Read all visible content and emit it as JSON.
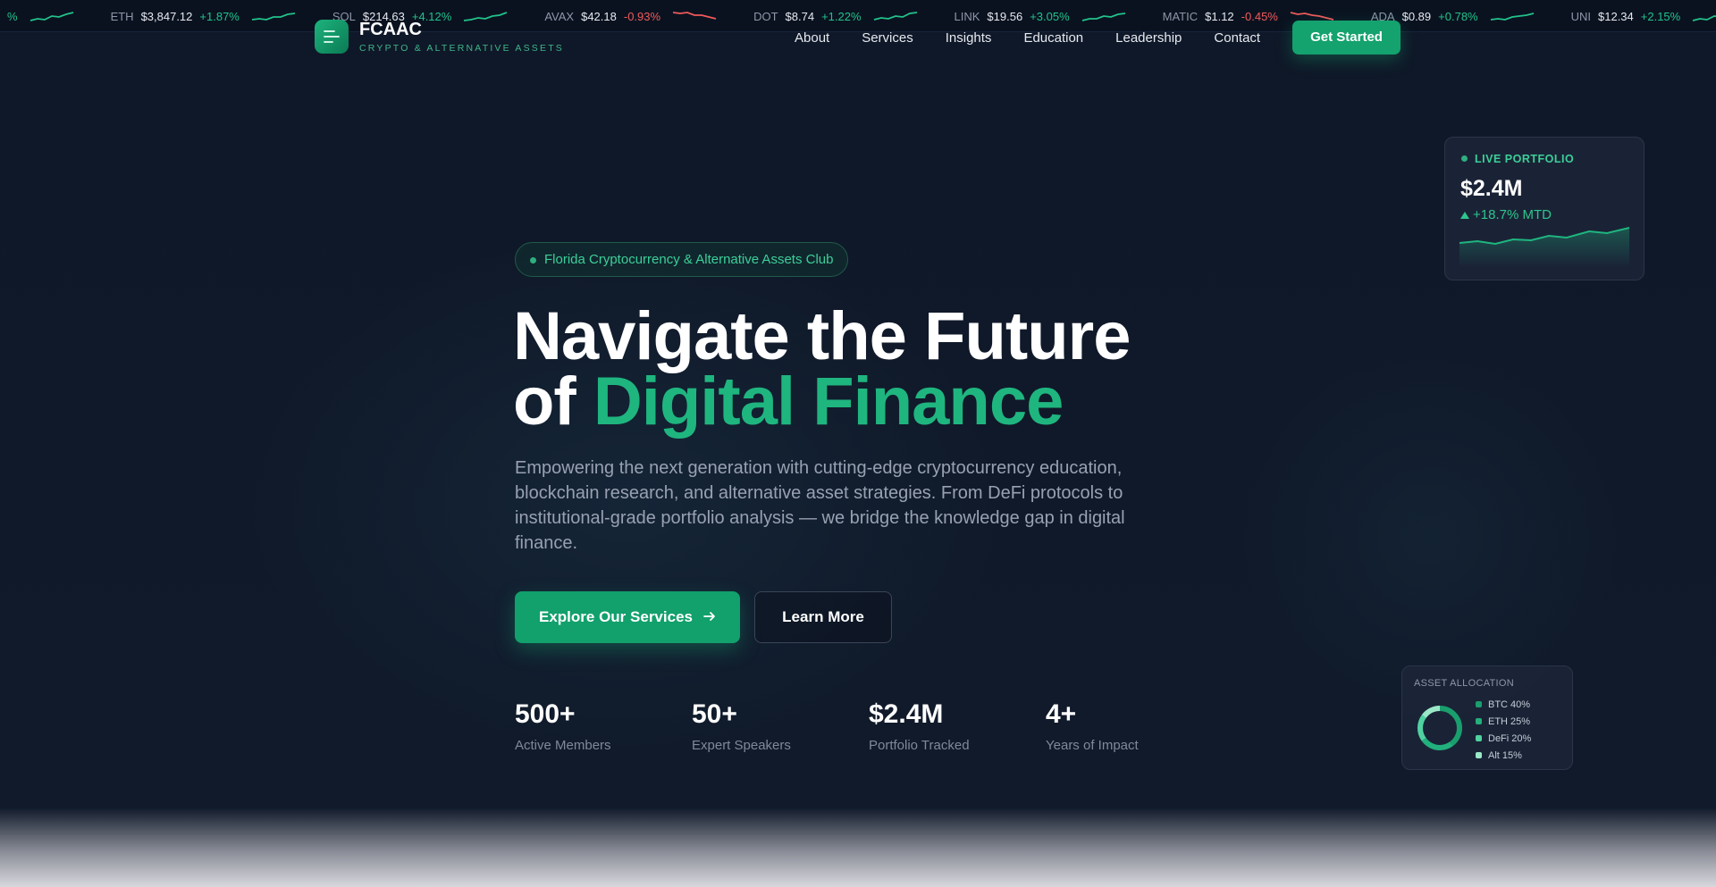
{
  "ticker": [
    {
      "symbol": "",
      "price": "",
      "change": "%",
      "dir": "up"
    },
    {
      "symbol": "ETH",
      "price": "$3,847.12",
      "change": "+1.87%",
      "dir": "up"
    },
    {
      "symbol": "SOL",
      "price": "$214.63",
      "change": "+4.12%",
      "dir": "up"
    },
    {
      "symbol": "AVAX",
      "price": "$42.18",
      "change": "-0.93%",
      "dir": "down"
    },
    {
      "symbol": "DOT",
      "price": "$8.74",
      "change": "+1.22%",
      "dir": "up"
    },
    {
      "symbol": "LINK",
      "price": "$19.56",
      "change": "+3.05%",
      "dir": "up"
    },
    {
      "symbol": "MATIC",
      "price": "$1.12",
      "change": "-0.45%",
      "dir": "down"
    },
    {
      "symbol": "ADA",
      "price": "$0.89",
      "change": "+0.78%",
      "dir": "up"
    },
    {
      "symbol": "UNI",
      "price": "$12.34",
      "change": "+2.15%",
      "dir": "up"
    }
  ],
  "header": {
    "logo_name": "FCAAC",
    "logo_tagline": "CRYPTO & ALTERNATIVE ASSETS",
    "logo_icon": "menu-icon",
    "nav": [
      "About",
      "Services",
      "Insights",
      "Education",
      "Leadership",
      "Contact"
    ],
    "cta": "Get Started"
  },
  "hero": {
    "pill": "Florida Cryptocurrency & Alternative Assets Club",
    "title_line1": "Navigate the Future",
    "title_line2_prefix": "of ",
    "title_line2_accent": "Digital Finance",
    "description": "Empowering the next generation with cutting-edge cryptocurrency education, blockchain research, and alternative asset strategies. From DeFi protocols to institutional-grade portfolio analysis — we bridge the knowledge gap in digital finance.",
    "primary_button": "Explore Our Services",
    "primary_button_icon": "arrow-right-icon",
    "secondary_button": "Learn More"
  },
  "stats": [
    {
      "value": "500+",
      "label": "Active Members"
    },
    {
      "value": "50+",
      "label": "Expert Speakers"
    },
    {
      "value": "$2.4M",
      "label": "Portfolio Tracked"
    },
    {
      "value": "4+",
      "label": "Years of Impact"
    }
  ],
  "portfolio_card": {
    "label": "LIVE PORTFOLIO",
    "value": "$2.4M",
    "change": "+18.7% MTD"
  },
  "allocation_card": {
    "label": "ASSET ALLOCATION",
    "items": [
      {
        "name": "BTC 40%",
        "color": "#1a9e6e",
        "share": 0.4
      },
      {
        "name": "ETH 25%",
        "color": "#22b07c",
        "share": 0.25
      },
      {
        "name": "DeFi 20%",
        "color": "#4fd2a0",
        "share": 0.2
      },
      {
        "name": "Alt 15%",
        "color": "#9be8c8",
        "share": 0.15
      }
    ]
  },
  "colors": {
    "accent": "#1fb57f",
    "up": "#22c38a",
    "down": "#ef5a5a",
    "background": "#0f1828"
  }
}
